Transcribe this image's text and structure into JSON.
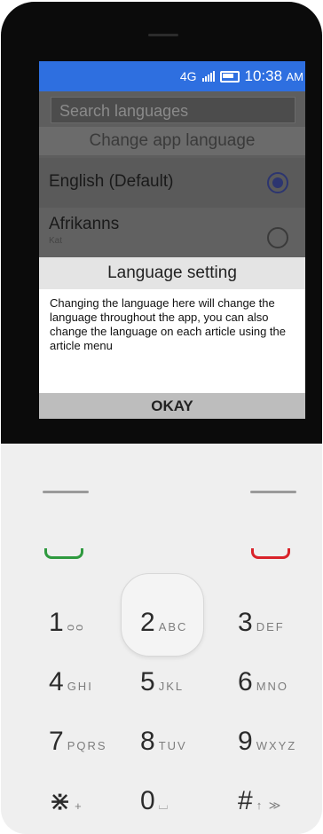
{
  "status": {
    "network": "4G",
    "time": "10:38",
    "ampm": "AM"
  },
  "app": {
    "search_placeholder": "Search languages",
    "header": "Change app language",
    "languages": [
      {
        "name": "English (Default)",
        "sub": "",
        "selected": true
      },
      {
        "name": "Afrikanns",
        "sub": "Kat",
        "selected": false
      }
    ]
  },
  "dialog": {
    "title": "Language setting",
    "body": "Changing the language here will change the language throughout the app, you can also change the language on each article using the article menu",
    "button": "OKAY"
  },
  "keypad": {
    "keys": [
      {
        "digit": "1",
        "letters": "ᴑᴑ"
      },
      {
        "digit": "2",
        "letters": "ABC"
      },
      {
        "digit": "3",
        "letters": "DEF"
      },
      {
        "digit": "4",
        "letters": "GHI"
      },
      {
        "digit": "5",
        "letters": "JKL"
      },
      {
        "digit": "6",
        "letters": "MNO"
      },
      {
        "digit": "7",
        "letters": "PQRS"
      },
      {
        "digit": "8",
        "letters": "TUV"
      },
      {
        "digit": "9",
        "letters": "WXYZ"
      },
      {
        "digit": "⋇",
        "letters": "+"
      },
      {
        "digit": "0",
        "letters": "⌴"
      },
      {
        "digit": "#",
        "letters": "↑ ≫"
      }
    ],
    "call_color": "#2f9a3f",
    "end_color": "#d9232a"
  },
  "colors": {
    "accent": "#2e6fe0"
  }
}
